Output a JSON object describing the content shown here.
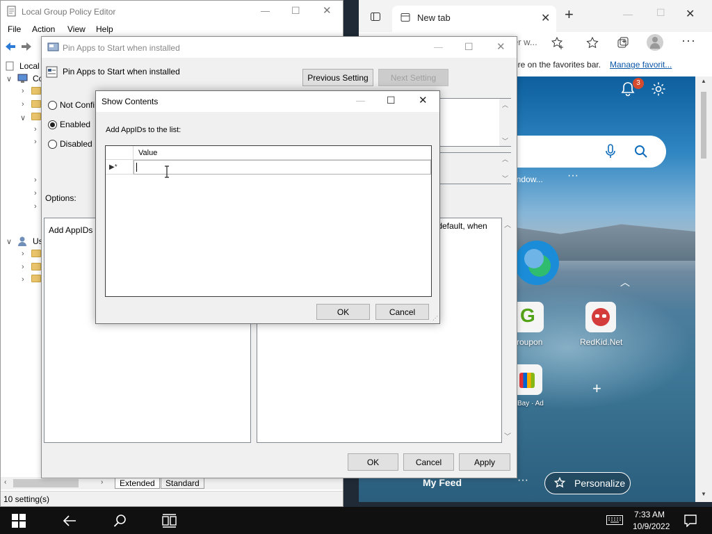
{
  "browser": {
    "tab_title": "New tab",
    "address_partial": "er w...",
    "favbar_text": "ere on the favorites bar.",
    "favbar_link": "Manage favorit...",
    "notification_count": "3",
    "windows_snippet": "indow...",
    "my_feed": "My Feed",
    "personalize": "Personalize",
    "tiles": [
      {
        "label": "roupon",
        "icon": "groupon-g-icon"
      },
      {
        "label": "RedKid.Net",
        "icon": "redkid-icon"
      },
      {
        "label": "Bay · Ad",
        "icon": "ebay-bag-icon"
      }
    ]
  },
  "gpe": {
    "title": "Local Group Policy Editor",
    "menu": [
      "File",
      "Action",
      "View",
      "Help"
    ],
    "tree_local": "Local",
    "tree_co": "Co",
    "tree_us": "Us",
    "tabs": [
      "Extended",
      "Standard"
    ],
    "status": "10 setting(s)"
  },
  "setting_dialog": {
    "title": "Pin Apps to Start when installed",
    "heading": "Pin Apps to Start when installed",
    "prev_button": "Previous Setting",
    "next_button": "Next Setting",
    "radio_not_configured": "Not Confi",
    "radio_enabled": "Enabled",
    "radio_disabled": "Disabled",
    "options_label": "Options:",
    "options_text": "Add AppIDs t",
    "help_text": "r default, when",
    "ok": "OK",
    "cancel": "Cancel",
    "apply": "Apply",
    "selected": "Enabled"
  },
  "show_contents": {
    "title": "Show Contents",
    "prompt": "Add AppIDs to the list:",
    "column_header": "Value",
    "row_marker": "▶*",
    "row_value": "",
    "ok": "OK",
    "cancel": "Cancel"
  },
  "taskbar": {
    "time": "7:33 AM",
    "date": "10/9/2022"
  }
}
